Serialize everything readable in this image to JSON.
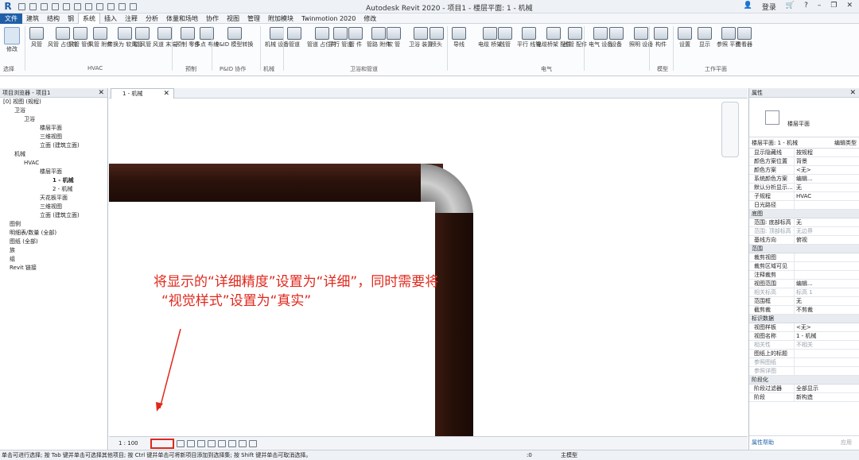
{
  "window": {
    "title": "Autodesk Revit 2020 - 项目1 - 楼层平面: 1 - 机械",
    "login": "登录"
  },
  "menu": [
    "文件",
    "建筑",
    "结构",
    "钢",
    "系统",
    "插入",
    "注释",
    "分析",
    "体量和场地",
    "协作",
    "视图",
    "管理",
    "附加模块",
    "Twinmotion 2020",
    "修改"
  ],
  "ribbon": {
    "buttons": [
      "修改",
      "风管",
      "风管\n占位符",
      "风管\n管件",
      "风管\n附件",
      "转换为\n软风管",
      "软\n风管",
      "风道\n末端",
      "预制\n零件",
      "多点\n布线",
      "P&ID 模型转换",
      "机械\n设备",
      "管道",
      "管道\n占位符",
      "平行\n管道",
      "管\n件",
      "管路\n附件",
      "软\n管",
      "卫浴\n装置",
      "喷头",
      "导线",
      "电缆\n桥架",
      "线管",
      "平行\n线管",
      "电缆桥架\n配件",
      "线管\n配件",
      "电气\n设备",
      "设备",
      "照明\n设备",
      "构件",
      "设置",
      "显示",
      "参照\n平面",
      "查看器"
    ],
    "groups": [
      "选择",
      "HVAC",
      "预制",
      "P&ID 协作",
      "机械",
      "卫浴和管道",
      "电气",
      "模型",
      "工作平面"
    ]
  },
  "browser": {
    "title": "项目浏览器 - 项目1",
    "items": [
      "[0] 视图 (规程)",
      "卫浴",
      "卫浴",
      "楼层平面",
      "三维视图",
      "立面 (建筑立面)",
      "机械",
      "HVAC",
      "楼层平面",
      "1 - 机械",
      "2 - 机械",
      "天花板平面",
      "三维视图",
      "立面 (建筑立面)",
      "图例",
      "明细表/数量 (全部)",
      "图纸 (全部)",
      "族",
      "组",
      "Revit 链接"
    ]
  },
  "viewtab": {
    "label": "1 - 机械"
  },
  "annotation": {
    "line1": "将显示的“详细精度”设置为“详细”，同时需要将",
    "line2": "“视觉样式”设置为“真实”"
  },
  "viewbar": {
    "scale": "1 : 100"
  },
  "properties": {
    "title": "属性",
    "type_name": "楼层平面",
    "selector": "楼层平面: 1 - 机械",
    "edit_type": "编辑类型",
    "rows": [
      [
        "显示隐藏线",
        "按规程"
      ],
      [
        "颜色方案位置",
        "背景"
      ],
      [
        "颜色方案",
        "<无>"
      ],
      [
        "系统颜色方案",
        "编辑..."
      ],
      [
        "默认分析显示...",
        "无"
      ],
      [
        "子规程",
        "HVAC"
      ],
      [
        "日光路径",
        ""
      ]
    ],
    "sec_range": "底图",
    "rows2": [
      [
        "范围: 底部标高",
        "无"
      ],
      [
        "范围: 顶部标高",
        "无边界"
      ],
      [
        "基线方向",
        "俯视"
      ]
    ],
    "sec_extents": "范围",
    "rows3": [
      [
        "裁剪视图",
        ""
      ],
      [
        "裁剪区域可见",
        ""
      ],
      [
        "注释裁剪",
        ""
      ],
      [
        "视图范围",
        "编辑..."
      ],
      [
        "相关标高",
        "标高 1"
      ],
      [
        "范围框",
        "无"
      ],
      [
        "截剪裁",
        "不剪裁"
      ]
    ],
    "sec_id": "标识数据",
    "rows4": [
      [
        "视图样板",
        "<无>"
      ],
      [
        "视图名称",
        "1 - 机械"
      ],
      [
        "相关性",
        "不相关"
      ],
      [
        "图纸上的标题",
        ""
      ],
      [
        "参照图纸",
        ""
      ],
      [
        "参照详图",
        ""
      ]
    ],
    "sec_phase": "阶段化",
    "rows5": [
      [
        "阶段过滤器",
        "全部显示"
      ],
      [
        "阶段",
        "新构造"
      ]
    ],
    "help": "属性帮助",
    "apply": "应用"
  },
  "status": {
    "text": "单击可进行选择; 按 Tab 键并单击可选择其他项目; 按 Ctrl 键并单击可将新项目添加到选择集; 按 Shift 键并单击可取消选择。",
    "model": "主模型",
    "zero": ":0"
  },
  "colors": {
    "annotation": "#e0281c",
    "pipe": "#2a120b",
    "accent": "#1f5fa8"
  }
}
